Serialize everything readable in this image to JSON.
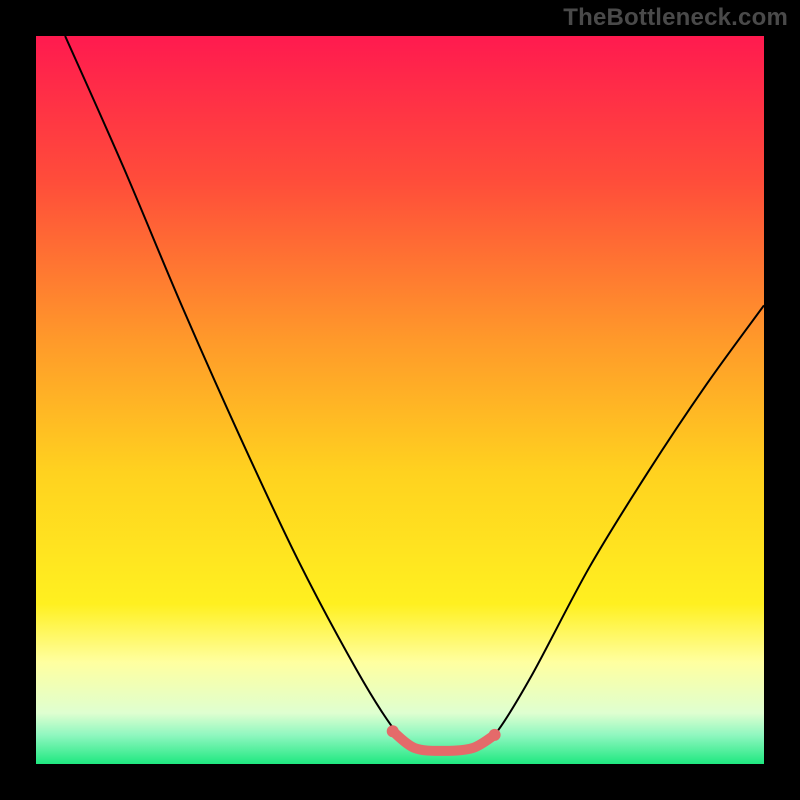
{
  "watermark": "TheBottleneck.com",
  "chart_data": {
    "type": "line",
    "title": "",
    "xlabel": "",
    "ylabel": "",
    "xlim": [
      0,
      100
    ],
    "ylim": [
      0,
      100
    ],
    "background_gradient": {
      "stops": [
        {
          "offset": 0.0,
          "color": "#ff1a4f"
        },
        {
          "offset": 0.2,
          "color": "#ff4d3a"
        },
        {
          "offset": 0.42,
          "color": "#ff9a2a"
        },
        {
          "offset": 0.6,
          "color": "#ffd21f"
        },
        {
          "offset": 0.78,
          "color": "#fff020"
        },
        {
          "offset": 0.86,
          "color": "#ffffa0"
        },
        {
          "offset": 0.93,
          "color": "#dfffd0"
        },
        {
          "offset": 0.96,
          "color": "#90f7c0"
        },
        {
          "offset": 1.0,
          "color": "#1fe880"
        }
      ]
    },
    "series": [
      {
        "name": "bottleneck-curve",
        "stroke": "#000000",
        "stroke_width": 2,
        "smooth": true,
        "points": [
          {
            "x": 4,
            "y": 100
          },
          {
            "x": 12,
            "y": 82
          },
          {
            "x": 20,
            "y": 63
          },
          {
            "x": 28,
            "y": 45
          },
          {
            "x": 36,
            "y": 28
          },
          {
            "x": 44,
            "y": 13
          },
          {
            "x": 49,
            "y": 5
          },
          {
            "x": 52,
            "y": 2
          },
          {
            "x": 56,
            "y": 1.5
          },
          {
            "x": 60,
            "y": 2
          },
          {
            "x": 63,
            "y": 4
          },
          {
            "x": 68,
            "y": 12
          },
          {
            "x": 76,
            "y": 27
          },
          {
            "x": 84,
            "y": 40
          },
          {
            "x": 92,
            "y": 52
          },
          {
            "x": 100,
            "y": 63
          }
        ]
      },
      {
        "name": "trough-highlight",
        "stroke": "#e46a6a",
        "stroke_width": 10,
        "linecap": "round",
        "smooth": true,
        "points": [
          {
            "x": 49,
            "y": 4.5
          },
          {
            "x": 52,
            "y": 2.2
          },
          {
            "x": 56,
            "y": 1.8
          },
          {
            "x": 60,
            "y": 2.2
          },
          {
            "x": 63,
            "y": 4.0
          }
        ]
      }
    ],
    "markers": [
      {
        "x": 49,
        "y": 4.5,
        "r": 6,
        "fill": "#e46a6a"
      },
      {
        "x": 63,
        "y": 4.0,
        "r": 6,
        "fill": "#e46a6a"
      }
    ]
  }
}
